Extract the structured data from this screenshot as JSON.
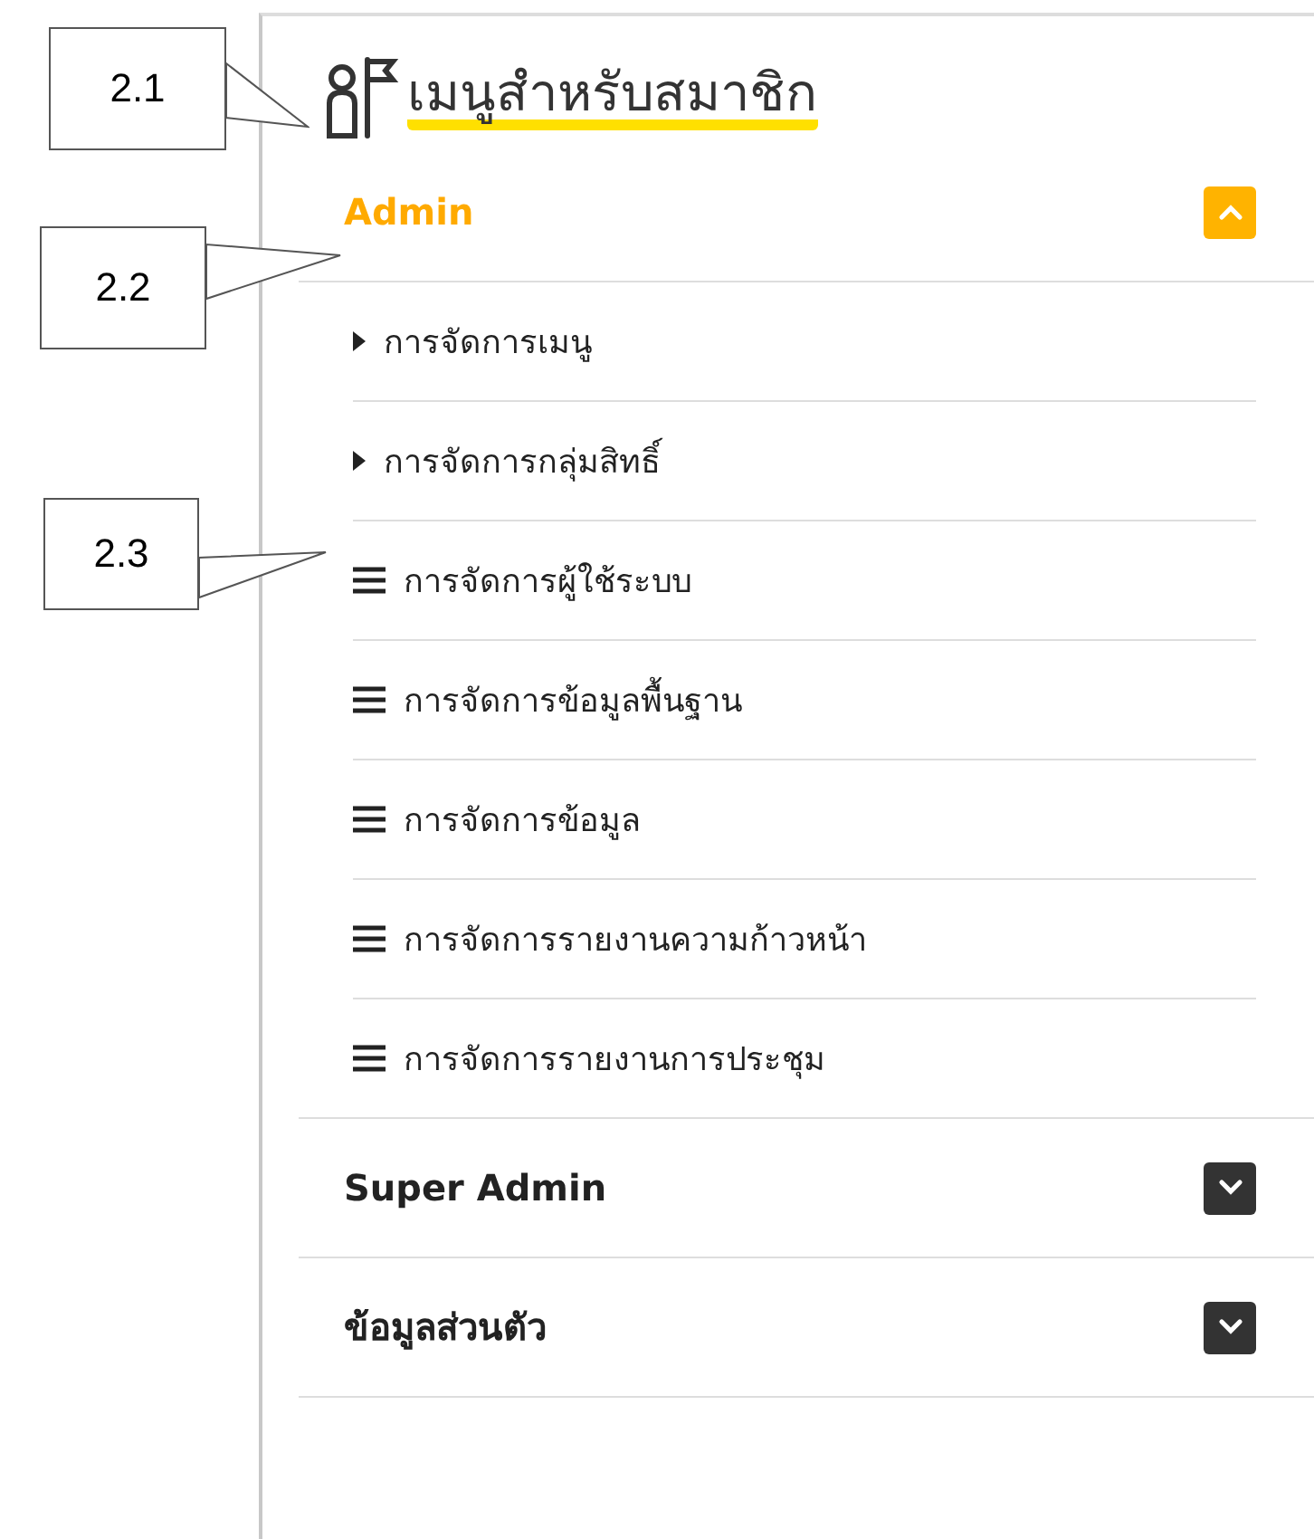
{
  "callouts": [
    {
      "label": "2.1"
    },
    {
      "label": "2.2"
    },
    {
      "label": "2.3"
    }
  ],
  "panel": {
    "title": "เมนูสำหรับสมาชิก",
    "sections": [
      {
        "title": "Admin",
        "expanded": true,
        "items": [
          {
            "kind": "caret",
            "label": "การจัดการเมนู"
          },
          {
            "kind": "caret",
            "label": "การจัดการกลุ่มสิทธิ์"
          },
          {
            "kind": "list",
            "label": "การจัดการผู้ใช้ระบบ"
          },
          {
            "kind": "list",
            "label": "การจัดการข้อมูลพื้นฐาน"
          },
          {
            "kind": "list",
            "label": "การจัดการข้อมูล"
          },
          {
            "kind": "list",
            "label": "การจัดการรายงานความก้าวหน้า"
          },
          {
            "kind": "list",
            "label": "การจัดการรายงานการประชุม"
          }
        ]
      },
      {
        "title": "Super Admin",
        "expanded": false
      },
      {
        "title": "ข้อมูลส่วนตัว",
        "expanded": false
      }
    ]
  }
}
